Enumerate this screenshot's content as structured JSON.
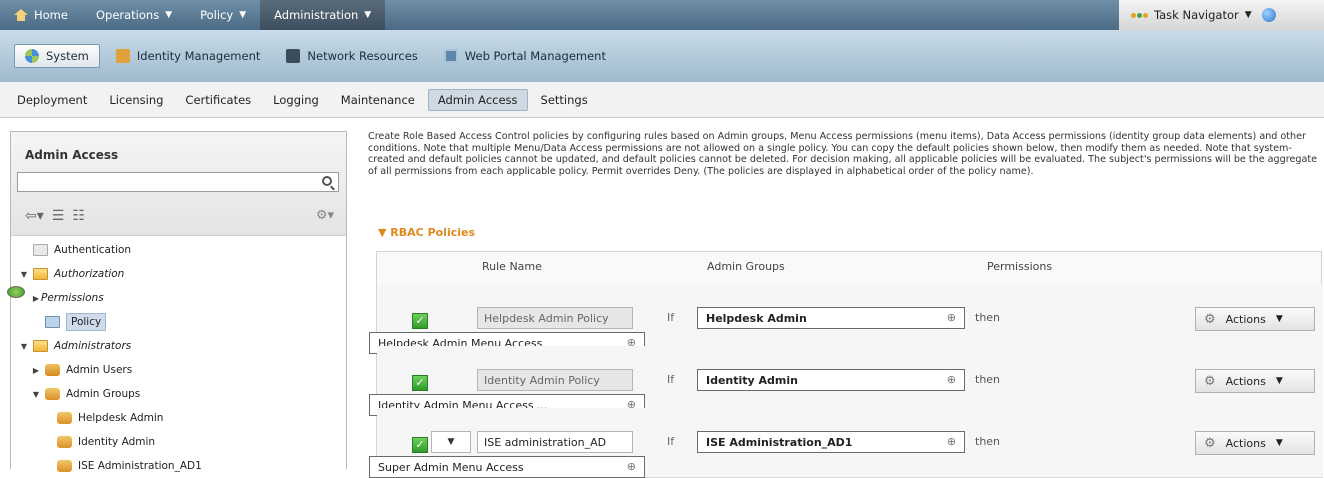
{
  "topnav": {
    "items": [
      {
        "label": "Home",
        "caret": false,
        "active": false
      },
      {
        "label": "Operations",
        "caret": true,
        "active": false
      },
      {
        "label": "Policy",
        "caret": true,
        "active": false
      },
      {
        "label": "Administration",
        "caret": true,
        "active": true
      }
    ],
    "task_navigator": "Task Navigator"
  },
  "systembar": {
    "items": [
      {
        "label": "System",
        "icon": "system-icon",
        "active": true
      },
      {
        "label": "Identity Management",
        "icon": "identity-icon",
        "active": false
      },
      {
        "label": "Network Resources",
        "icon": "network-icon",
        "active": false
      },
      {
        "label": "Web Portal Management",
        "icon": "web-portal-icon",
        "active": false
      }
    ]
  },
  "subnav": {
    "tabs": [
      {
        "label": "Deployment",
        "active": false
      },
      {
        "label": "Licensing",
        "active": false
      },
      {
        "label": "Certificates",
        "active": false
      },
      {
        "label": "Logging",
        "active": false
      },
      {
        "label": "Maintenance",
        "active": false
      },
      {
        "label": "Admin Access",
        "active": true
      },
      {
        "label": "Settings",
        "active": false
      }
    ]
  },
  "sidebar": {
    "title": "Admin Access",
    "search_value": "",
    "tree": [
      {
        "label": "Authentication",
        "level": 0,
        "arrow": "",
        "icon": "auth",
        "italic": false,
        "selected": false
      },
      {
        "label": "Authorization",
        "level": 0,
        "arrow": "▼",
        "icon": "folder",
        "italic": true,
        "selected": false
      },
      {
        "label": "Permissions",
        "level": 1,
        "arrow": "▶",
        "icon": "perm",
        "italic": true,
        "selected": false
      },
      {
        "label": "Policy",
        "level": 1,
        "arrow": "",
        "icon": "policy",
        "italic": false,
        "selected": true
      },
      {
        "label": "Administrators",
        "level": 0,
        "arrow": "▼",
        "icon": "folder",
        "italic": true,
        "selected": false
      },
      {
        "label": "Admin Users",
        "level": 1,
        "arrow": "▶",
        "icon": "users",
        "italic": false,
        "selected": false
      },
      {
        "label": "Admin Groups",
        "level": 1,
        "arrow": "▼",
        "icon": "group",
        "italic": false,
        "selected": false
      },
      {
        "label": "Helpdesk Admin",
        "level": 2,
        "arrow": "",
        "icon": "group",
        "italic": false,
        "selected": false
      },
      {
        "label": "Identity Admin",
        "level": 2,
        "arrow": "",
        "icon": "group",
        "italic": false,
        "selected": false
      },
      {
        "label": "ISE Administration_AD1",
        "level": 2,
        "arrow": "",
        "icon": "group",
        "italic": false,
        "selected": false
      }
    ]
  },
  "content": {
    "description": "Create Role Based Access Control policies by configuring rules based on Admin groups, Menu Access permissions (menu items), Data Access permissions (identity group data elements) and other conditions. Note that multiple Menu/Data Access permissions are not allowed on a single policy. You can copy the default policies shown below, then modify them as needed. Note that system-created and default policies cannot be updated, and default policies cannot be deleted. For decision making, all applicable policies will be evaluated. The subject's permissions will be the aggregate of all permissions from each applicable policy. Permit overrides Deny. (The policies are displayed in alphabetical order of the policy name).",
    "section_title": "RBAC Policies",
    "columns": {
      "rule_name": "Rule Name",
      "admin_groups": "Admin Groups",
      "permissions": "Permissions"
    },
    "rules": [
      {
        "name": "Helpdesk Admin Policy",
        "editable": false,
        "if": "If",
        "group": "Helpdesk Admin",
        "then": "then",
        "permission": "Helpdesk Admin Menu Access",
        "actions": "Actions"
      },
      {
        "name": "Identity Admin Policy",
        "editable": false,
        "if": "If",
        "group": "Identity Admin",
        "then": "then",
        "permission": "Identity Admin Menu Access ...",
        "actions": "Actions"
      },
      {
        "name": "ISE administration_AD",
        "editable": true,
        "if": "If",
        "group": "ISE Administration_AD1",
        "then": "then",
        "permission": "Super Admin Menu Access",
        "actions": "Actions"
      }
    ]
  }
}
